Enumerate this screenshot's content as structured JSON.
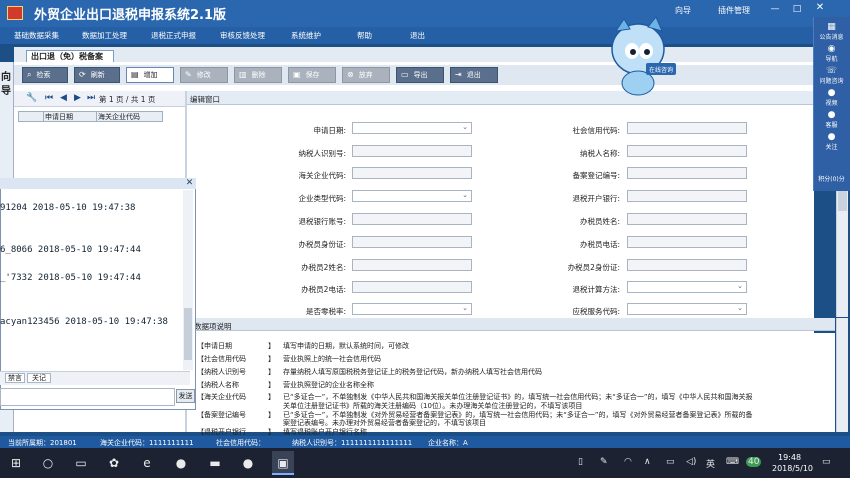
{
  "app": {
    "title": "外贸企业出口退税申报系统2.1版",
    "user": "向导",
    "settings": "插件管理",
    "mascot_badge": "在线咨询"
  },
  "menu": [
    "基础数据采集",
    "数据加工处理",
    "退税正式申报",
    "审核反馈处理",
    "系统维护",
    "帮助",
    "退出"
  ],
  "left_vertical": [
    "向",
    "导"
  ],
  "tab": {
    "label": "出口退（免）税备案"
  },
  "toolbar": [
    {
      "label": "检索",
      "icon": "search-icon",
      "state": "normal"
    },
    {
      "label": "刷新",
      "icon": "refresh-icon",
      "state": "normal"
    },
    {
      "label": "增加",
      "icon": "add-icon",
      "state": "active"
    },
    {
      "label": "修改",
      "icon": "edit-icon",
      "state": "disabled"
    },
    {
      "label": "删除",
      "icon": "delete-icon",
      "state": "disabled"
    },
    {
      "label": "保存",
      "icon": "save-icon",
      "state": "disabled"
    },
    {
      "label": "放弃",
      "icon": "cancel-icon",
      "state": "disabled"
    },
    {
      "label": "导出",
      "icon": "export-icon",
      "state": "normal"
    },
    {
      "label": "退出",
      "icon": "exit-icon",
      "state": "normal"
    }
  ],
  "navigator": {
    "page_text": "第 1 页 / 共 1 页"
  },
  "list": {
    "columns": [
      "申请日期",
      "海关企业代码"
    ]
  },
  "edit_window": {
    "title": "编辑窗口"
  },
  "form": {
    "left_labels": [
      "申请日期:",
      "纳税人识别号:",
      "海关企业代码:",
      "企业类型代码:",
      "退税银行账号:",
      "办税员身份证:",
      "办税员2姓名:",
      "办税员2电话:",
      "是否零税率:"
    ],
    "right_labels": [
      "社会信用代码:",
      "纳税人名称:",
      "备案登记编号:",
      "退税开户银行:",
      "办税员姓名:",
      "办税员电话:",
      "办税员2身份证:",
      "退税计算方法:",
      "应税服务代码:"
    ]
  },
  "desc": {
    "title": "数据项说明",
    "rows": [
      {
        "key": "【申请日期",
        "val": "填写申请的日期，默认系统时间，可修改"
      },
      {
        "key": "【社会信用代码",
        "val": "营业执照上的统一社会信用代码"
      },
      {
        "key": "【纳税人识别号",
        "val": "存量纳税人填写原国税税务登记证上的税务登记代码，新办纳税人填写社会信用代码"
      },
      {
        "key": "【纳税人名称",
        "val": "营业执照登记的企业名称全称"
      },
      {
        "key": "【海关企业代码",
        "val": "已“多证合一”，不单独制发《中华人民共和国海关报关单位注册登记证书》的，填写统一社会信用代码；未“多证合一”的，填写《中华人民共和国海关报"
      },
      {
        "key": "",
        "val": "关单位注册登记证书》所载的海关注册编码（10位）。未办理海关单位注册登记的，不填写该项目"
      },
      {
        "key": "【备案登记编号",
        "val": "已“多证合一”，不单独制发《对外贸易经营者备案登记表》的，填写统一社会信用代码；未“多证合一”的，填写《对外贸易经营者备案登记表》所载的备"
      },
      {
        "key": "",
        "val": "案登记表编号。未办理对外贸易经营者备案登记的，不填写该项目"
      },
      {
        "key": "【退税开户银行",
        "val": "填写退税账户开户银行名称"
      }
    ]
  },
  "log_window": {
    "lines": [
      "91204  2018-05-10 19:47:38",
      "6_8066  2018-05-10 19:47:44",
      "_'7332  2018-05-10 19:47:44",
      "acyan123456  2018-05-10 19:47:38"
    ],
    "tabs": [
      "禁言",
      "关记"
    ],
    "send_label": "发送"
  },
  "right_sidebar": [
    "公告消息",
    "导航",
    "问题咨询",
    "视频",
    "客服",
    "关注",
    "积分(0)分"
  ],
  "status": {
    "period": "当前所属期：201801",
    "customs_code": "海关企业代码：1111111111",
    "credit_code": "社会信用代码：",
    "taxpayer_id": "纳税人识别号：1111111111111111",
    "company_name": "企业名称：A"
  },
  "taskbar": {
    "time": "19:48",
    "date": "2018/5/10",
    "lang": "英",
    "badge": "40"
  }
}
